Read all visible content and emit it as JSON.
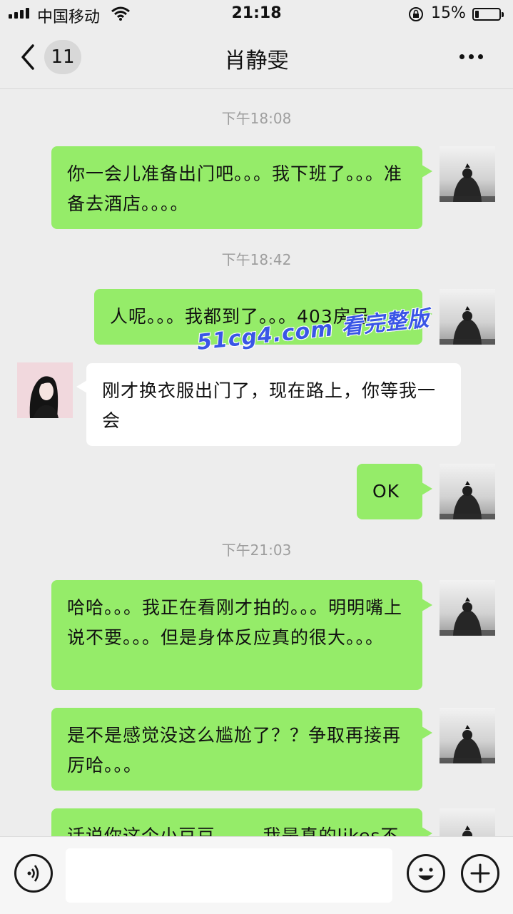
{
  "status_bar": {
    "carrier": "中国移动",
    "time": "21:18",
    "battery_percent": "15%",
    "battery_level": 0.15
  },
  "nav": {
    "back_badge": "11",
    "title": "肖静雯"
  },
  "watermark": "51cg4.com 看完整版",
  "timestamps": [
    "下午18:08",
    "下午18:42",
    "下午21:03"
  ],
  "messages": [
    {
      "side": "right",
      "text": "你一会儿准备出门吧。。。我下班了。。。准备去酒店。。。。"
    },
    {
      "side": "right",
      "text": "人呢。。。我都到了。。。403房号"
    },
    {
      "side": "left",
      "text": "刚才换衣服出门了，现在路上，你等我一会"
    },
    {
      "side": "right",
      "text": "OK"
    },
    {
      "side": "right",
      "text": "哈哈。。。我正在看刚才拍的。。。明明嘴上说不要。。。但是身体反应真的很大。。。"
    },
    {
      "side": "right",
      "text": "是不是感觉没这么尴尬了？？争取再接再厉哈。。。"
    },
    {
      "side": "right",
      "text": "话说你这个小豆豆。。。。我是真的likes不"
    }
  ],
  "input": {
    "placeholder": ""
  },
  "colors": {
    "background": "#ededed",
    "outgoing_bubble": "#95ec69",
    "incoming_bubble": "#ffffff",
    "timestamp": "#9e9e9e"
  },
  "icons": {
    "back": "chevron-left-icon",
    "more": "more-dots-icon",
    "voice": "voice-icon",
    "emoji": "emoji-icon",
    "plus": "plus-icon"
  }
}
